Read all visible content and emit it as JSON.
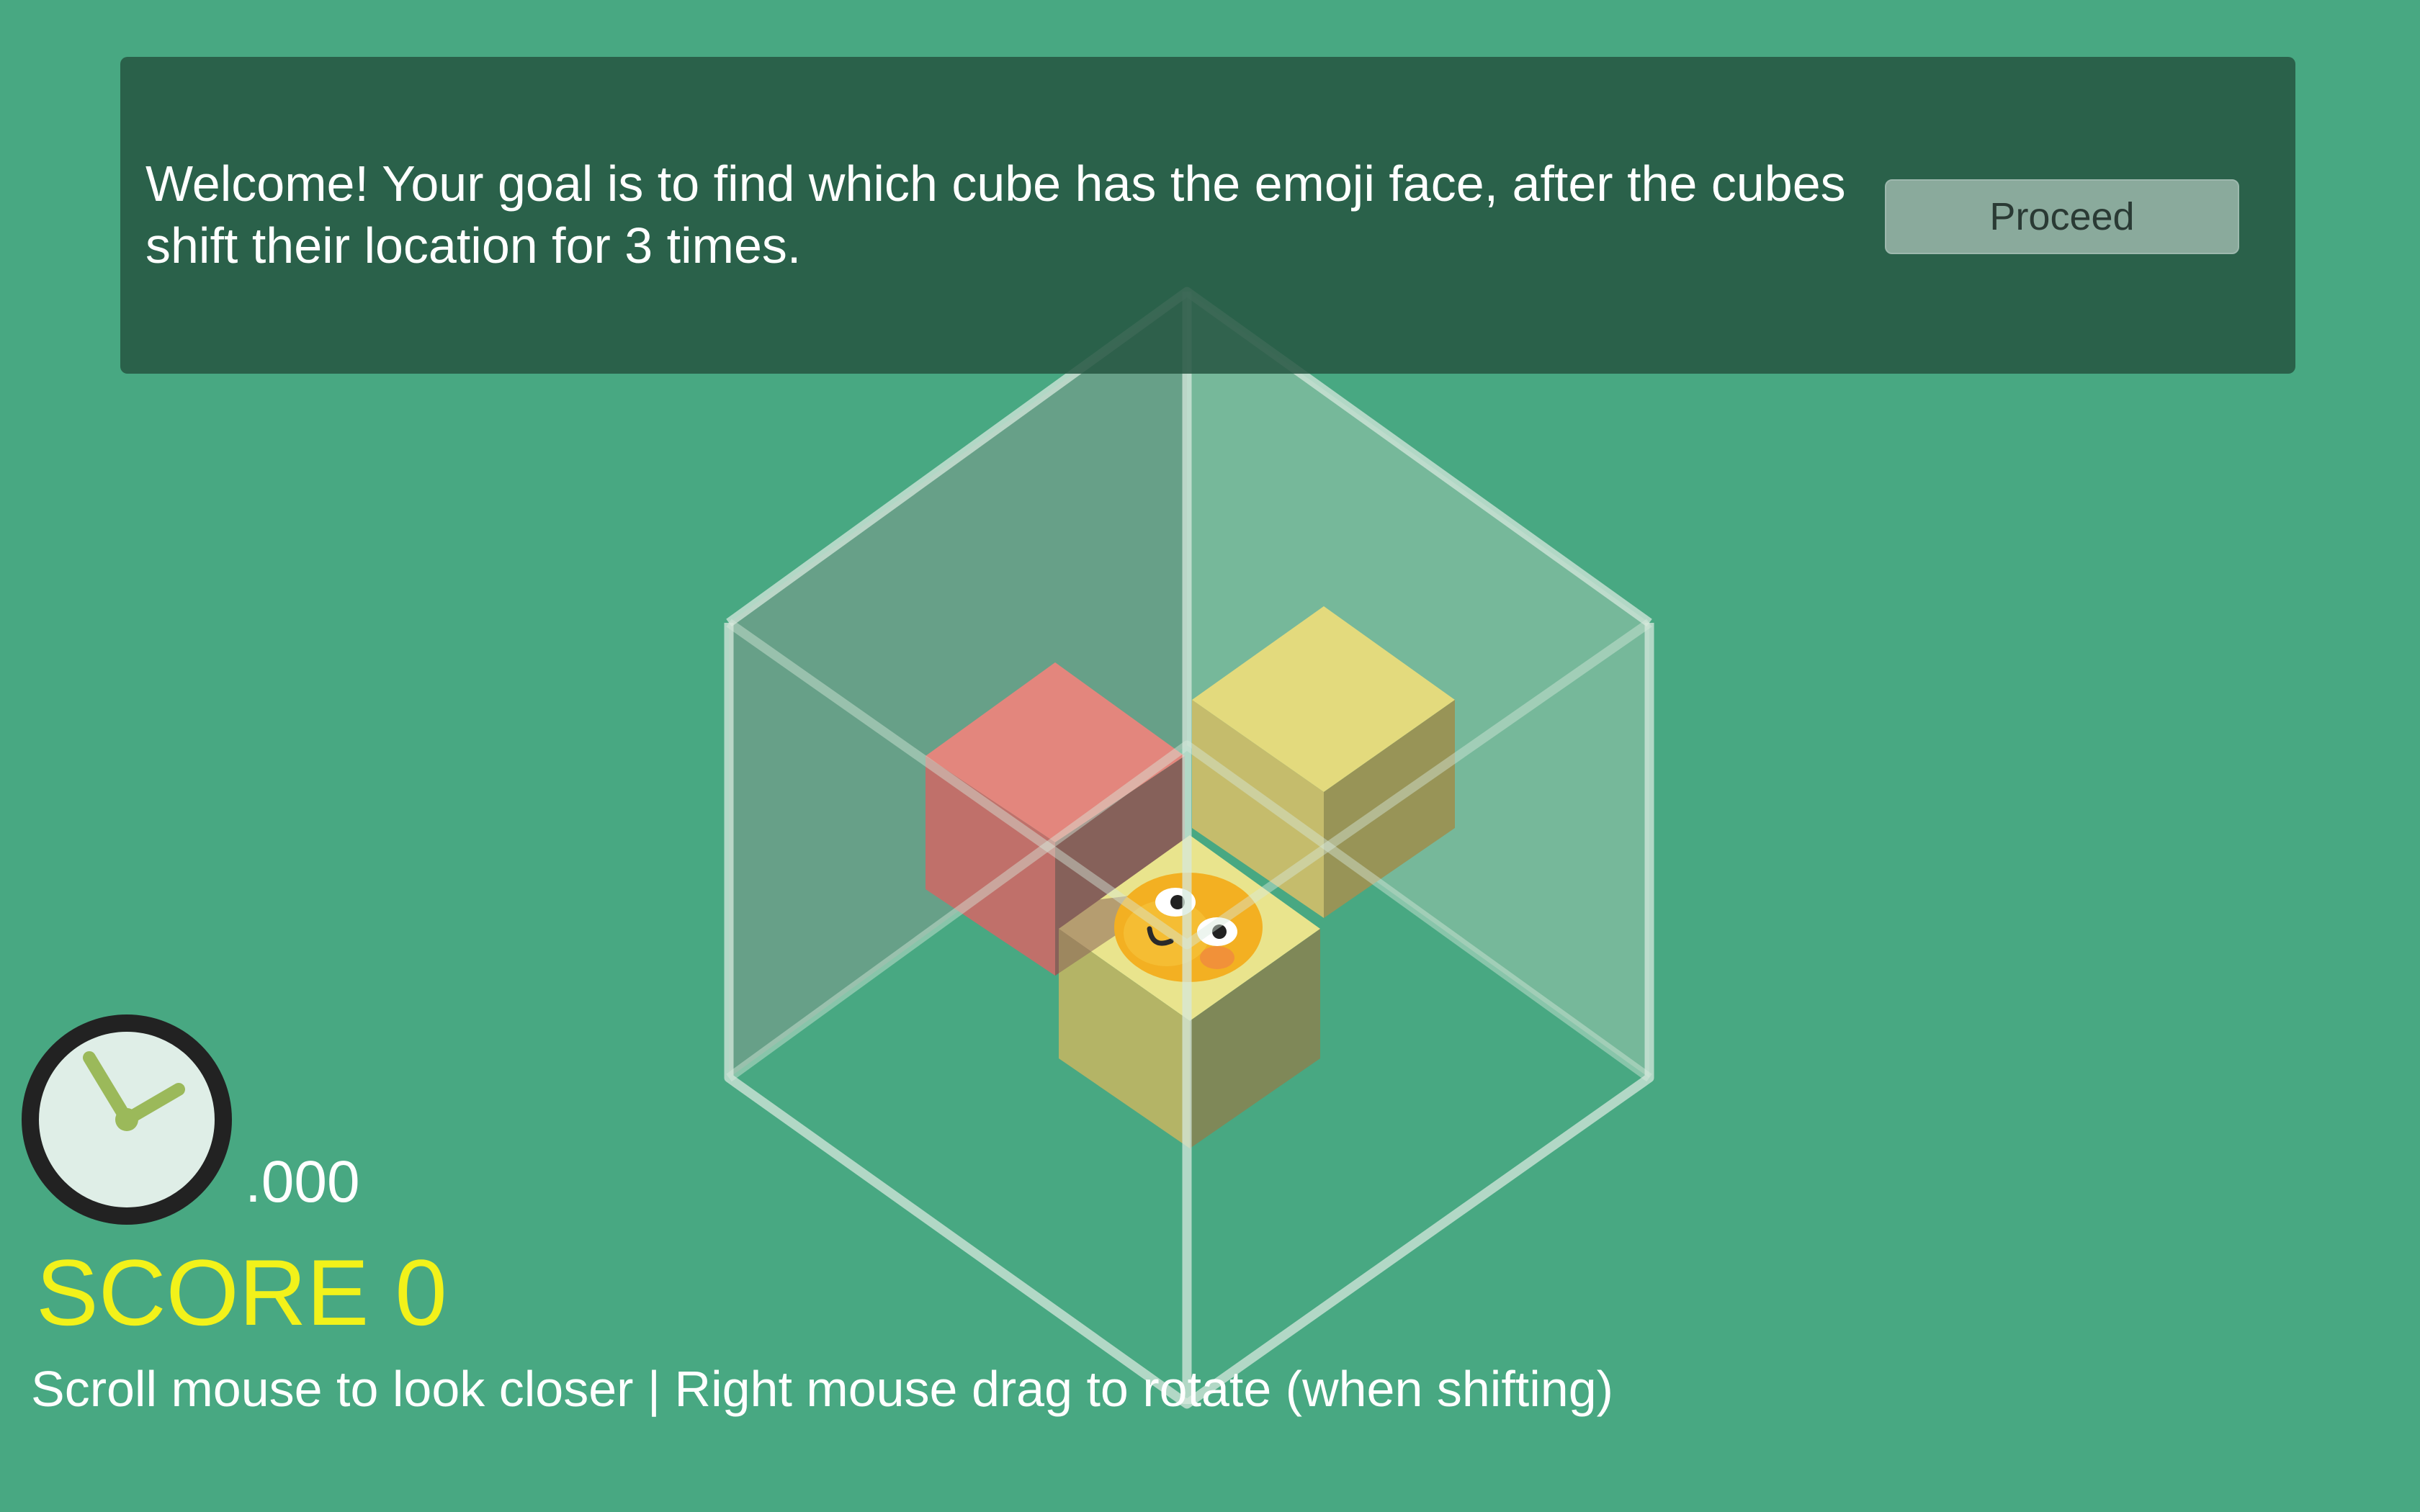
{
  "banner": {
    "message": "Welcome! Your goal is to find which cube has the emoji face, after the cubes shift their location for 3 times.",
    "proceed_label": "Proceed"
  },
  "hud": {
    "timer": ".000",
    "score": "SCORE 0",
    "hint": "Scroll mouse to look closer | Right mouse drag to rotate (when shifting)"
  },
  "colors": {
    "background": "#48a882",
    "banner": "#255541",
    "score": "#f2f21a",
    "red_cube": "#e08a82",
    "yellow_cube": "#e3da7d",
    "emoji": "#f3b022"
  },
  "icons": {
    "clock": "clock-icon",
    "emoji": "emoji-face-icon"
  }
}
